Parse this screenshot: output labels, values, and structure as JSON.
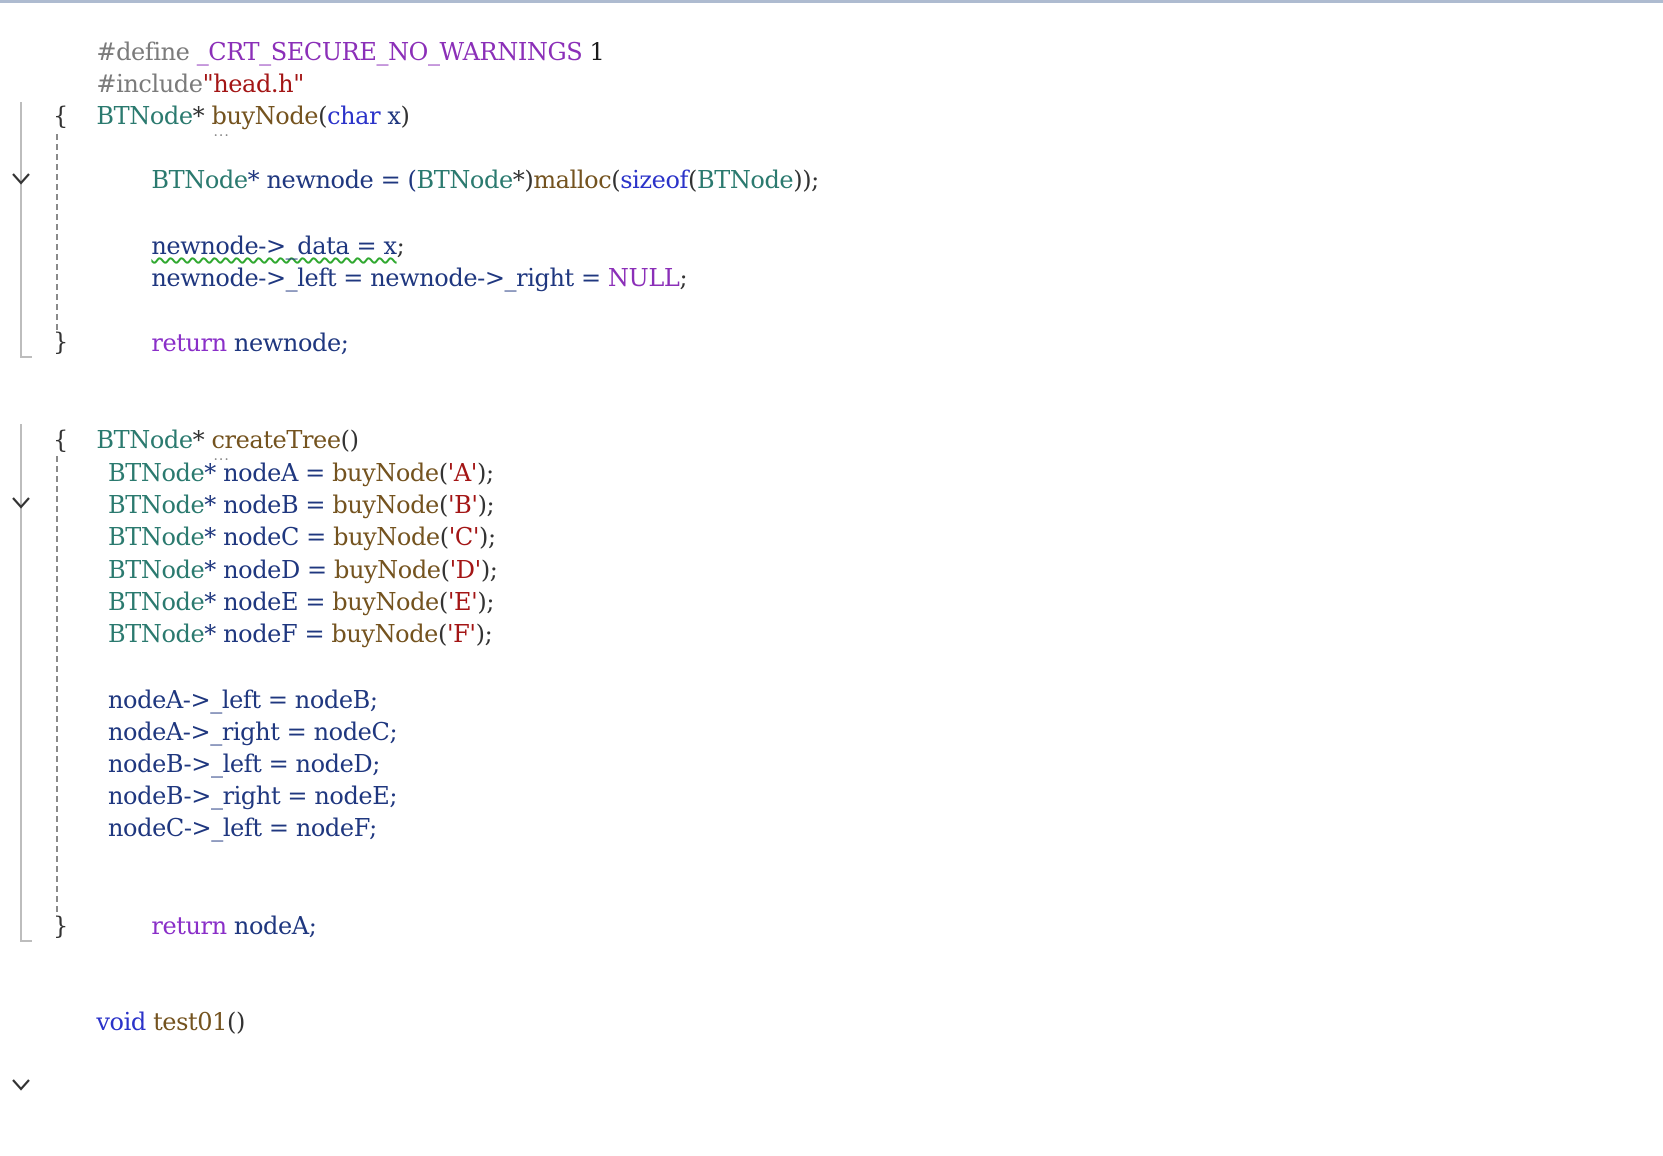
{
  "editor": {
    "lines": {
      "l1": {
        "a": "#define ",
        "b": "_CRT_SECURE_NO_WARNINGS",
        "c": " 1"
      },
      "l2": {
        "a": "#include",
        "b": "\"head.h\""
      },
      "l3": {
        "a": "BTNode",
        "b": "* ",
        "c": "buyNode",
        "d": "(",
        "e": "char",
        "f": " x",
        "g": ")"
      },
      "l4": {
        "a": "{"
      },
      "l5": {
        "a": "BTNode",
        "b": "* newnode = (",
        "c": "BTNode",
        "d": "*)",
        "e": "malloc",
        "f": "(",
        "g": "sizeof",
        "h": "(",
        "i": "BTNode",
        "j": "));"
      },
      "l6": {
        "a": "newnode->_data = x",
        "b": ";"
      },
      "l7": {
        "a": "newnode->_left = newnode->_right = ",
        "b": "NULL",
        "c": ";"
      },
      "l8": {
        "a": "return",
        "b": " newnode;"
      },
      "l9": {
        "a": "}"
      },
      "l10": {
        "a": "BTNode",
        "b": "* ",
        "c": "createTree",
        "d": "()"
      },
      "l11": {
        "a": "{"
      },
      "l12": {
        "t": "BTNode",
        "v": "* nodeA = ",
        "f": "buyNode",
        "p": "(",
        "c": "'A'",
        "e": ");"
      },
      "l13": {
        "t": "BTNode",
        "v": "* nodeB = ",
        "f": "buyNode",
        "p": "(",
        "c": "'B'",
        "e": ");"
      },
      "l14": {
        "t": "BTNode",
        "v": "* nodeC = ",
        "f": "buyNode",
        "p": "(",
        "c": "'C'",
        "e": ");"
      },
      "l15": {
        "t": "BTNode",
        "v": "* nodeD = ",
        "f": "buyNode",
        "p": "(",
        "c": "'D'",
        "e": ");"
      },
      "l16": {
        "t": "BTNode",
        "v": "* nodeE = ",
        "f": "buyNode",
        "p": "(",
        "c": "'E'",
        "e": ");"
      },
      "l17": {
        "t": "BTNode",
        "v": "* nodeF = ",
        "f": "buyNode",
        "p": "(",
        "c": "'F'",
        "e": ");"
      },
      "l18": {
        "a": "nodeA->_left = nodeB;"
      },
      "l19": {
        "a": "nodeA->_right = nodeC;"
      },
      "l20": {
        "a": "nodeB->_left = nodeD;"
      },
      "l21": {
        "a": "nodeB->_right = nodeE;"
      },
      "l22": {
        "a": "nodeC->_left = nodeF;"
      },
      "l23": {
        "a": "return",
        "b": " nodeA;"
      },
      "l24": {
        "a": "}"
      },
      "l25": {
        "a": "void",
        "b": " ",
        "c": "test01",
        "d": "()"
      }
    },
    "fold_icon": "chevron-down-icon",
    "colors": {
      "type": "#2b7a6f",
      "keyword": "#2b33c9",
      "control_keyword": "#8a2fc8",
      "function": "#74531f",
      "variable": "#1f377f",
      "string": "#a31515",
      "macro": "#8b2fb8",
      "preprocessor": "#7b7b7b",
      "squiggle": "#2fa82f"
    }
  }
}
